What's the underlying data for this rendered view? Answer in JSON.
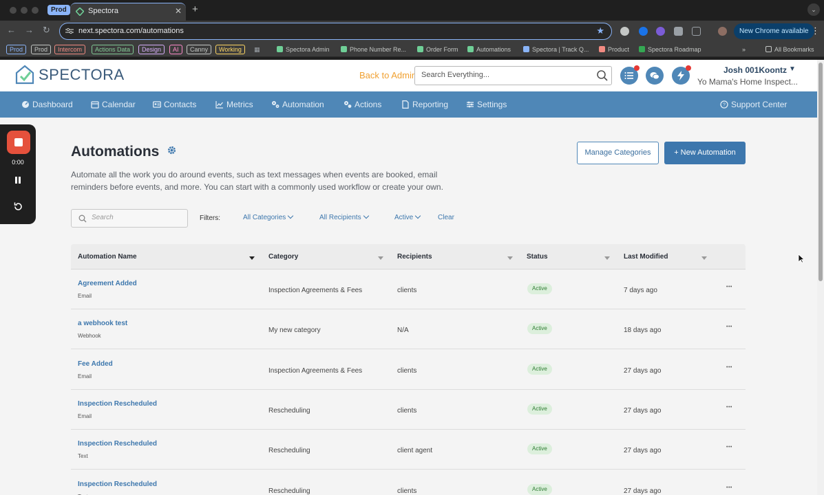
{
  "browser": {
    "tab_group": "Prod",
    "tab_title": "Spectora",
    "url": "next.spectora.com/automations",
    "new_chrome_label": "New Chrome available",
    "bookmark_chips": [
      {
        "label": "Prod",
        "color": "#8ab4f8"
      },
      {
        "label": "Prod",
        "color": "#c4c7c5"
      },
      {
        "label": "Intercom",
        "color": "#f28b82"
      },
      {
        "label": "Actions Data",
        "color": "#81c995"
      },
      {
        "label": "Design",
        "color": "#d7aefb"
      },
      {
        "label": "AI",
        "color": "#ff8bcb"
      },
      {
        "label": "Canny",
        "color": "#c4c7c5"
      },
      {
        "label": "Working",
        "color": "#fdd663"
      }
    ],
    "bookmarks": [
      {
        "label": "Spectora Admin",
        "icon": "spectora-icon"
      },
      {
        "label": "Phone Number Re...",
        "icon": "spectora-icon"
      },
      {
        "label": "Order Form",
        "icon": "spectora-icon"
      },
      {
        "label": "Automations",
        "icon": "spectora-icon"
      },
      {
        "label": "Spectora | Track Q...",
        "icon": "track-icon"
      },
      {
        "label": "Product",
        "icon": "product-icon"
      },
      {
        "label": "Spectora Roadmap",
        "icon": "sheets-icon"
      }
    ],
    "all_bookmarks": "All Bookmarks"
  },
  "header": {
    "logo_text": "SPECTORA",
    "back_to_admin": "Back to Admin",
    "search_placeholder": "Search Everything...",
    "user_name": "Josh 001Koontz",
    "company": "Yo Mama's Home Inspect..."
  },
  "nav": [
    {
      "label": "Dashboard",
      "icon": "dashboard-icon"
    },
    {
      "label": "Calendar",
      "icon": "calendar-icon"
    },
    {
      "label": "Contacts",
      "icon": "contacts-icon"
    },
    {
      "label": "Metrics",
      "icon": "metrics-icon"
    },
    {
      "label": "Automation",
      "icon": "automation-icon"
    },
    {
      "label": "Actions",
      "icon": "actions-icon"
    },
    {
      "label": "Reporting",
      "icon": "reporting-icon"
    },
    {
      "label": "Settings",
      "icon": "settings-icon"
    },
    {
      "label": "Support Center",
      "icon": "support-icon"
    }
  ],
  "recorder": {
    "time": "0:00"
  },
  "page": {
    "title": "Automations",
    "description": "Automate all the work you do around events, such as text messages when events are booked, email reminders before events, and more. You can start with a commonly used workflow or create your own.",
    "manage_categories": "Manage Categories",
    "new_automation": "+ New Automation",
    "search_placeholder": "Search",
    "filters_label": "Filters:",
    "filter_categories": "All Categories",
    "filter_recipients": "All Recipients",
    "filter_status": "Active",
    "clear": "Clear"
  },
  "table": {
    "columns": [
      "Automation Name",
      "Category",
      "Recipients",
      "Status",
      "Last Modified"
    ],
    "rows": [
      {
        "name": "Agreement Added",
        "type": "Email",
        "category": "Inspection Agreements & Fees",
        "recipients": "clients",
        "status": "Active",
        "modified": "7 days ago"
      },
      {
        "name": "a webhook test",
        "type": "Webhook",
        "category": "My new category",
        "recipients": "N/A",
        "status": "Active",
        "modified": "18 days ago"
      },
      {
        "name": "Fee Added",
        "type": "Email",
        "category": "Inspection Agreements & Fees",
        "recipients": "clients",
        "status": "Active",
        "modified": "27 days ago"
      },
      {
        "name": "Inspection Rescheduled",
        "type": "Email",
        "category": "Rescheduling",
        "recipients": "clients",
        "status": "Active",
        "modified": "27 days ago"
      },
      {
        "name": "Inspection Rescheduled",
        "type": "Text",
        "category": "Rescheduling",
        "recipients": "client agent",
        "status": "Active",
        "modified": "27 days ago"
      },
      {
        "name": "Inspection Rescheduled",
        "type": "Text",
        "category": "Rescheduling",
        "recipients": "clients",
        "status": "Active",
        "modified": "27 days ago"
      }
    ]
  }
}
